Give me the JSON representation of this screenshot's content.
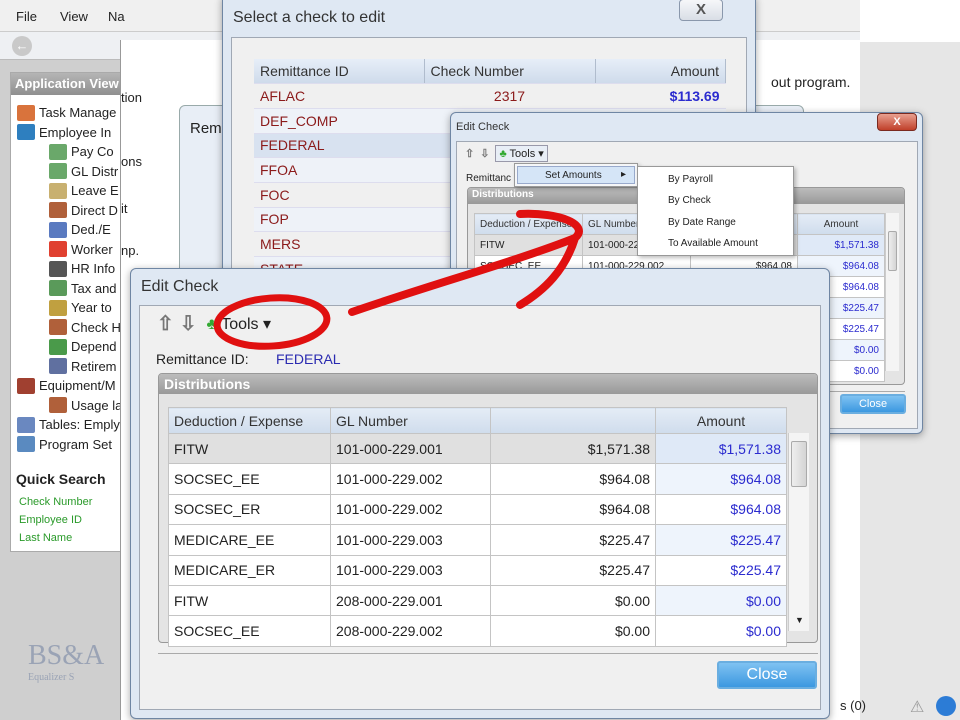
{
  "menubar": {
    "items": [
      "File",
      "View",
      "Na"
    ]
  },
  "sidebar": {
    "title": "Application View",
    "items": [
      "Task Manage",
      "Employee In",
      "Pay Co",
      "GL Distr",
      "Leave E",
      "Direct D",
      "Ded./E",
      "Worker",
      "HR Info",
      "Tax and",
      "Year to",
      "Check H",
      "Depend",
      "Retirem",
      "Equipment/M",
      "Usage la",
      "Tables: Emply",
      "Program Set"
    ],
    "quick_search_title": "Quick Search",
    "quick_search_links": [
      "Check Number",
      "Employee ID",
      "Last Name"
    ]
  },
  "background": {
    "fragments": [
      "tion",
      "ons",
      "it",
      "np."
    ],
    "out_program": "out program.",
    "rem_dialog_title": "Rem",
    "status_count": "s (0)",
    "logo_text": "BS&A",
    "logo_sub": "Equalizer S"
  },
  "select_dialog": {
    "title": "Select a check to edit",
    "close": "X",
    "columns": [
      "Remittance ID",
      "Check Number",
      "Amount"
    ],
    "rows": [
      [
        "AFLAC",
        "2317",
        "$113.69"
      ],
      [
        "DEF_COMP",
        "",
        ""
      ],
      [
        "FEDERAL",
        "",
        ""
      ],
      [
        "FFOA",
        "",
        ""
      ],
      [
        "FOC",
        "",
        ""
      ],
      [
        "FOP",
        "",
        ""
      ],
      [
        "MERS",
        "",
        ""
      ],
      [
        "STATE",
        "",
        ""
      ]
    ]
  },
  "edit_check": {
    "title": "Edit Check",
    "tools_label": "Tools",
    "remittance_label": "Remittance ID:",
    "remittance_value": "FEDERAL",
    "distributions_title": "Distributions",
    "columns": [
      "Deduction / Expense",
      "GL Number",
      "",
      "Amount"
    ],
    "rows": [
      [
        "FITW",
        "101-000-229.001",
        "$1,571.38",
        "$1,571.38"
      ],
      [
        "SOCSEC_EE",
        "101-000-229.002",
        "$964.08",
        "$964.08"
      ],
      [
        "SOCSEC_ER",
        "101-000-229.002",
        "$964.08",
        "$964.08"
      ],
      [
        "MEDICARE_EE",
        "101-000-229.003",
        "$225.47",
        "$225.47"
      ],
      [
        "MEDICARE_ER",
        "101-000-229.003",
        "$225.47",
        "$225.47"
      ],
      [
        "FITW",
        "208-000-229.001",
        "$0.00",
        "$0.00"
      ],
      [
        "SOCSEC_EE",
        "208-000-229.002",
        "$0.00",
        "$0.00"
      ]
    ],
    "close_label": "Close",
    "small_remittance_label": "Remittanc",
    "tools_menu": {
      "set_amounts": "Set Amounts",
      "submenu": [
        "By Payroll",
        "By Check",
        "By Date Range",
        "To Available Amount"
      ]
    },
    "x": "X"
  },
  "colors": {
    "annotation": "#e01010",
    "link_blue": "#2b2bcf",
    "remit_red": "#8b1a1a",
    "quick_search_green": "#2a9a2a"
  }
}
